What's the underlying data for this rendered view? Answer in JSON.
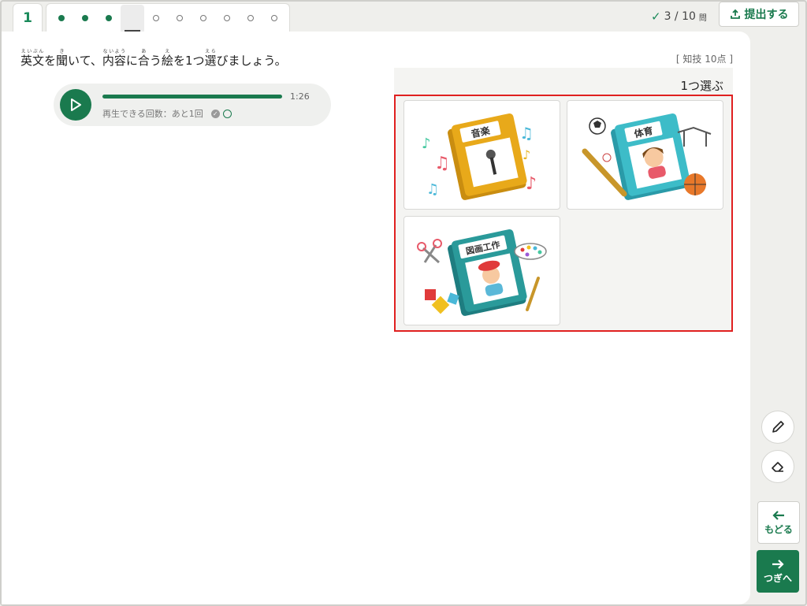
{
  "nav": {
    "current_number": "1",
    "questions": [
      "done",
      "done",
      "done",
      "current",
      "todo",
      "todo",
      "todo",
      "todo",
      "todo",
      "todo"
    ]
  },
  "progress": {
    "text": "3 / 10",
    "unit": "問"
  },
  "submit_label": "提出する",
  "question": {
    "segments": [
      {
        "base": "英文",
        "ruby": "えいぶん"
      },
      {
        "text": "を"
      },
      {
        "base": "聞",
        "ruby": "き"
      },
      {
        "text": "いて、"
      },
      {
        "base": "内容",
        "ruby": "ないよう"
      },
      {
        "text": "に"
      },
      {
        "base": "合",
        "ruby": "あ"
      },
      {
        "text": "う"
      },
      {
        "base": "絵",
        "ruby": "え"
      },
      {
        "text": "を1つ"
      },
      {
        "base": "選",
        "ruby": "えら"
      },
      {
        "text": "びましょう。"
      }
    ]
  },
  "score_label": "[ 知技 10点 ]",
  "audio": {
    "duration": "1:26",
    "progress": 1.0,
    "replay_text": "再生できる回数：あと1回"
  },
  "answer": {
    "instruction": "1つ選ぶ",
    "choices": [
      {
        "book_label": "音楽",
        "book_color": "#e8a91a",
        "icon": "music-book-icon"
      },
      {
        "book_label": "体育",
        "book_color": "#3dbcc8",
        "icon": "pe-book-icon"
      },
      {
        "book_label": "図画工作",
        "book_color": "#2a9a9a",
        "icon": "art-book-icon"
      }
    ]
  },
  "tools": {
    "pen_icon": "pencil-icon",
    "eraser_icon": "eraser-icon"
  },
  "back_label": "もどる",
  "next_label": "つぎへ",
  "colors": {
    "accent": "#1a7a4e",
    "selection_border": "#e02020"
  }
}
